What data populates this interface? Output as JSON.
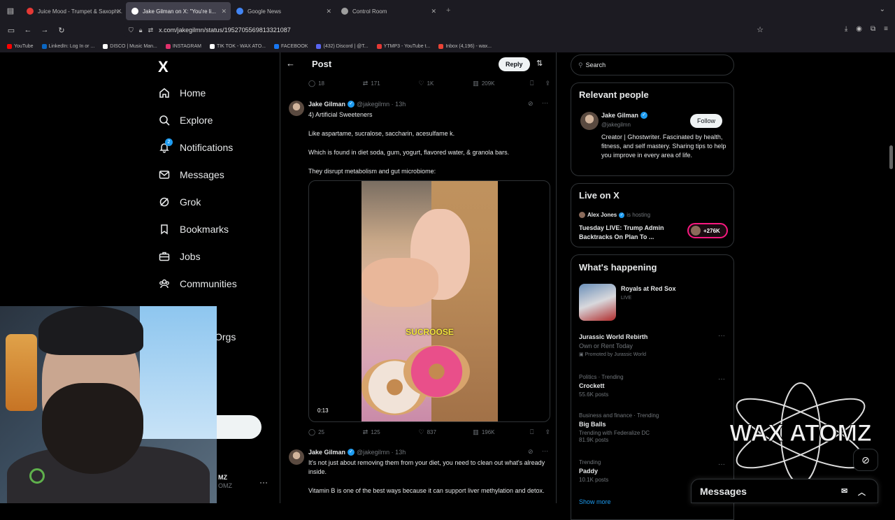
{
  "browser": {
    "tabs": [
      {
        "label": "Juice Mood - Trumpet & Saxoph...",
        "color": "#e53935"
      },
      {
        "label": "Jake Gilman on X: \"You're li...",
        "color": "#ffffff"
      },
      {
        "label": "Google News",
        "color": "#4285f4"
      },
      {
        "label": "Control Room",
        "color": "#9e9e9e"
      }
    ],
    "new_tab": "+",
    "url": "x.com/jakegilmn/status/1952705569813321087",
    "bookmarks": [
      {
        "label": "YouTube",
        "color": "#ff0000"
      },
      {
        "label": "LinkedIn: Log In or ...",
        "color": "#0a66c2"
      },
      {
        "label": "DISCO | Music Man...",
        "color": "#ffffff"
      },
      {
        "label": "INSTAGRAM",
        "color": "#e1306c"
      },
      {
        "label": "TIK TOK - WAX ATO...",
        "color": "#ffffff"
      },
      {
        "label": "FACEBOOK",
        "color": "#1877f2"
      },
      {
        "label": "(432) Discord | @T...",
        "color": "#5865f2"
      },
      {
        "label": "YTMP3 - YouTube t...",
        "color": "#e53935"
      },
      {
        "label": "Inbox (4,196) - wax...",
        "color": "#ea4335"
      }
    ]
  },
  "nav": {
    "logo": "X",
    "items": [
      {
        "label": "Home",
        "icon": "home-icon"
      },
      {
        "label": "Explore",
        "icon": "search-icon"
      },
      {
        "label": "Notifications",
        "icon": "bell-icon"
      },
      {
        "label": "Messages",
        "icon": "envelope-icon"
      },
      {
        "label": "Grok",
        "icon": "grok-icon"
      },
      {
        "label": "Bookmarks",
        "icon": "bookmark-icon"
      },
      {
        "label": "Jobs",
        "icon": "briefcase-icon"
      },
      {
        "label": "Communities",
        "icon": "people-icon"
      }
    ],
    "notification_count": "2",
    "partial_item": "Orgs",
    "account_fragment_1": "MZ",
    "account_fragment_2": "OMZ",
    "more": "···"
  },
  "post": {
    "header_title": "Post",
    "reply_label": "Reply",
    "top_stats": {
      "replies": "18",
      "reposts": "171",
      "likes": "1K",
      "views": "209K"
    },
    "tweet1": {
      "name": "Jake Gilman",
      "handle": "@jakegilmn · 13h",
      "line1": "4) Artificial Sweeteners",
      "line2": "Like aspartame, sucralose, saccharin, acesulfame k.",
      "line3": "Which is found in diet soda, gum, yogurt, flavored water, & granola bars.",
      "line4": "They disrupt metabolism and gut microbiome:",
      "video_caption": "SUCROOSE",
      "video_time": "0:13",
      "stats": {
        "replies": "25",
        "reposts": "125",
        "likes": "837",
        "views": "196K"
      }
    },
    "tweet2": {
      "name": "Jake Gilman",
      "handle": "@jakegilmn · 13h",
      "line1": "It's not just about removing them from your diet, you need to clean out what's already inside.",
      "line2": "Vitamin B is one of the best ways because it can support liver methylation and detox."
    }
  },
  "sidebar": {
    "search_placeholder": "Search",
    "relevant": {
      "title": "Relevant people",
      "name": "Jake Gilman",
      "handle": "@jakegilmn",
      "follow": "Follow",
      "bio": "Creator | Ghostwriter. Fascinated by health, fitness, and self mastery. Sharing tips to help you improve in every area of life."
    },
    "live": {
      "title": "Live on X",
      "host": "Alex Jones",
      "status": "is hosting",
      "headline": "Tuesday LIVE: Trump Admin Backtracks On Plan To ...",
      "count": "+276K"
    },
    "happening": {
      "title": "What's happening",
      "featured": {
        "title": "Royals at Red Sox",
        "status": "LIVE"
      },
      "trends": [
        {
          "label": "",
          "title": "Jurassic World Rebirth",
          "extra": "Own or Rent Today",
          "count": "Promoted by Jurassic World"
        },
        {
          "label": "Politics · Trending",
          "title": "Crockett",
          "extra": "",
          "count": "55.6K posts"
        },
        {
          "label": "Business and finance · Trending",
          "title": "Big Balls",
          "extra": "Trending with Federalize DC",
          "count": "81.9K posts"
        },
        {
          "label": "Trending",
          "title": "Paddy",
          "extra": "",
          "count": "10.1K posts"
        }
      ],
      "show_more": "Show more"
    }
  },
  "overlays": {
    "watermark_text": "WAX ATOMZ",
    "messages": "Messages"
  },
  "colors": {
    "accent": "#1d9bf0",
    "live": "#f91880"
  }
}
